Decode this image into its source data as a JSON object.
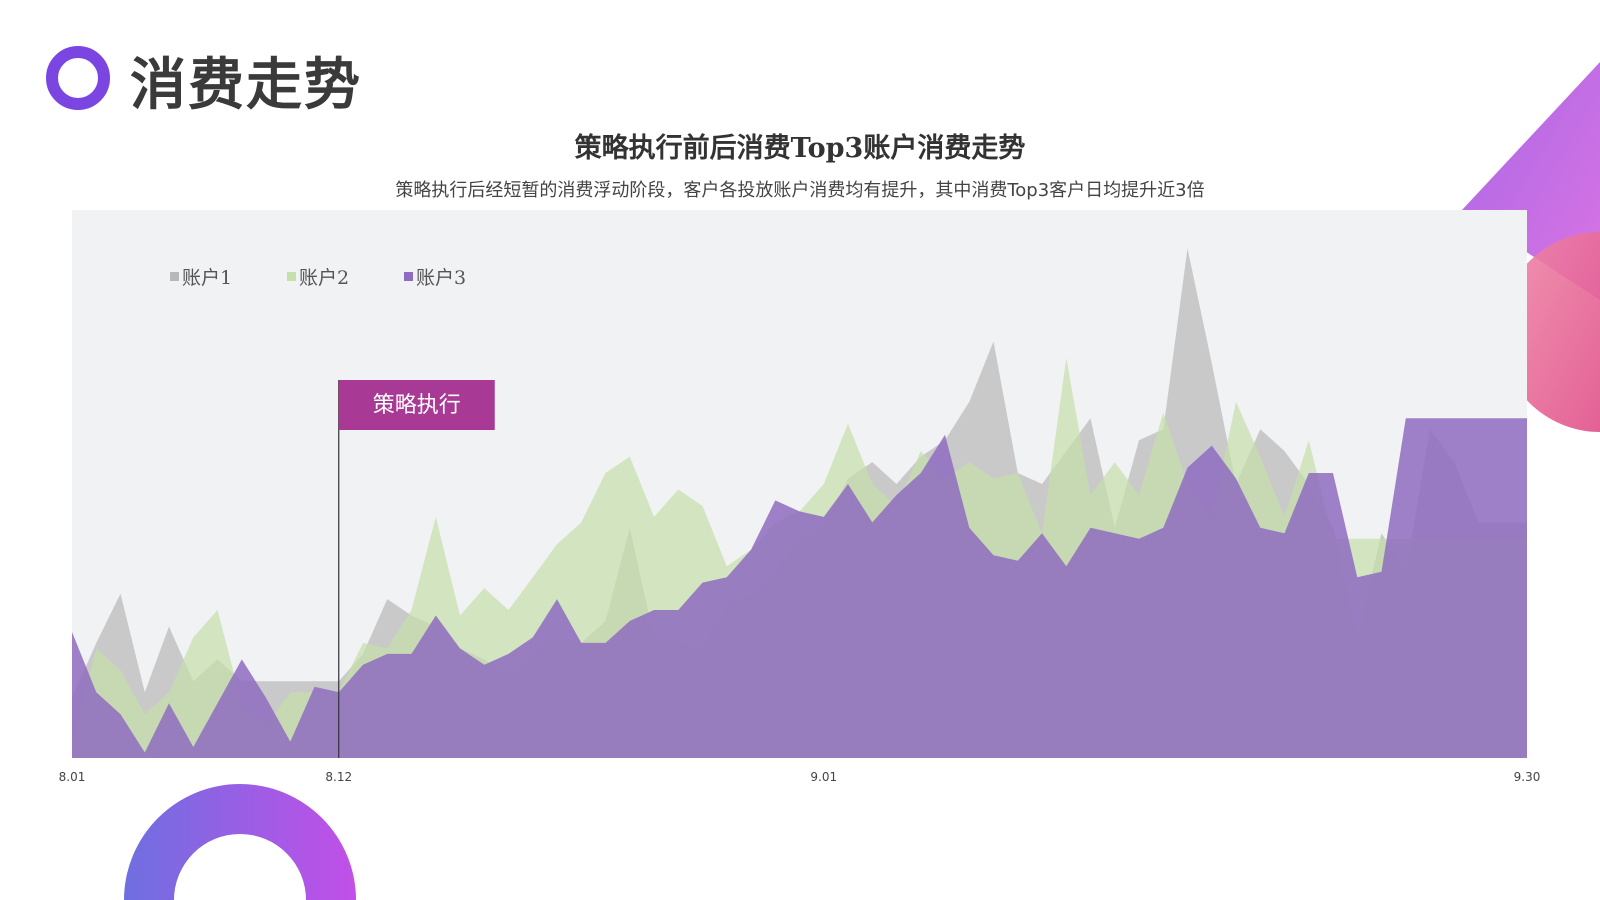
{
  "slide": {
    "title": "消费走势"
  },
  "chart_data": {
    "type": "area",
    "title": "策略执行前后消费Top3账户消费走势",
    "subtitle": "策略执行后经短暂的消费浮动阶段，客户各投放账户消费均有提升，其中消费Top3客户日均提升近3倍",
    "x": [
      "8.01",
      "8.02",
      "8.03",
      "8.04",
      "8.05",
      "8.06",
      "8.07",
      "8.08",
      "8.09",
      "8.10",
      "8.11",
      "8.12",
      "8.13",
      "8.14",
      "8.15",
      "8.16",
      "8.17",
      "8.18",
      "8.19",
      "8.20",
      "8.21",
      "8.22",
      "8.23",
      "8.24",
      "8.25",
      "8.26",
      "8.27",
      "8.28",
      "8.29",
      "8.30",
      "8.31",
      "9.01",
      "9.02",
      "9.03",
      "9.04",
      "9.05",
      "9.06",
      "9.07",
      "9.08",
      "9.09",
      "9.10",
      "9.11",
      "9.12",
      "9.13",
      "9.14",
      "9.15",
      "9.16",
      "9.17",
      "9.18",
      "9.19",
      "9.20",
      "9.21",
      "9.22",
      "9.23",
      "9.24",
      "9.25",
      "9.26",
      "9.27",
      "9.28",
      "9.29",
      "9.30"
    ],
    "x_tick_labels": [
      "8.01",
      "8.12",
      "9.01",
      "9.30"
    ],
    "y_axis_visible": false,
    "ylim": [
      0,
      100
    ],
    "grid": false,
    "legend_position": "top-left",
    "series": [
      {
        "name": "账户1",
        "color": "#b8b8b8",
        "opacity": 0.7,
        "values": [
          11,
          21,
          30,
          12,
          24,
          14,
          18,
          14,
          14,
          14,
          14,
          14,
          19,
          29,
          26,
          24,
          20,
          18,
          15,
          19,
          22,
          21,
          25,
          42,
          22,
          21,
          20,
          28,
          30,
          34,
          40,
          42,
          51,
          54,
          50,
          55,
          58,
          65,
          76,
          52,
          50,
          56,
          62,
          42,
          58,
          60,
          93,
          72,
          50,
          60,
          56,
          50,
          42,
          22,
          41,
          34,
          60,
          54,
          43,
          43,
          43
        ]
      },
      {
        "name": "账户2",
        "color": "#c5e0aa",
        "opacity": 0.7,
        "values": [
          3,
          20,
          16,
          8,
          12,
          22,
          27,
          10,
          6,
          12,
          12,
          12,
          21,
          20,
          27,
          44,
          26,
          31,
          27,
          33,
          39,
          43,
          52,
          55,
          44,
          49,
          46,
          35,
          38,
          43,
          45,
          50,
          61,
          50,
          46,
          56,
          51,
          54,
          51,
          52,
          41,
          73,
          48,
          54,
          48,
          63,
          50,
          44,
          65,
          55,
          44,
          58,
          40,
          40,
          40,
          40,
          40,
          40,
          40,
          40,
          40
        ]
      },
      {
        "name": "账户3",
        "color": "#8e6cc0",
        "opacity": 0.85,
        "values": [
          23,
          12,
          8,
          1,
          10,
          2,
          10,
          18,
          11,
          3,
          13,
          12,
          17,
          19,
          19,
          26,
          20,
          17,
          19,
          22,
          29,
          21,
          21,
          25,
          27,
          27,
          32,
          33,
          38,
          47,
          45,
          44,
          50,
          43,
          48,
          52,
          59,
          42,
          37,
          36,
          41,
          35,
          42,
          41,
          40,
          42,
          53,
          57,
          51,
          42,
          41,
          52,
          52,
          33,
          34,
          62,
          62,
          62,
          62,
          62,
          62
        ]
      }
    ],
    "annotations": [
      {
        "text": "策略执行",
        "x": "8.12",
        "color": "#a83a95"
      }
    ]
  }
}
